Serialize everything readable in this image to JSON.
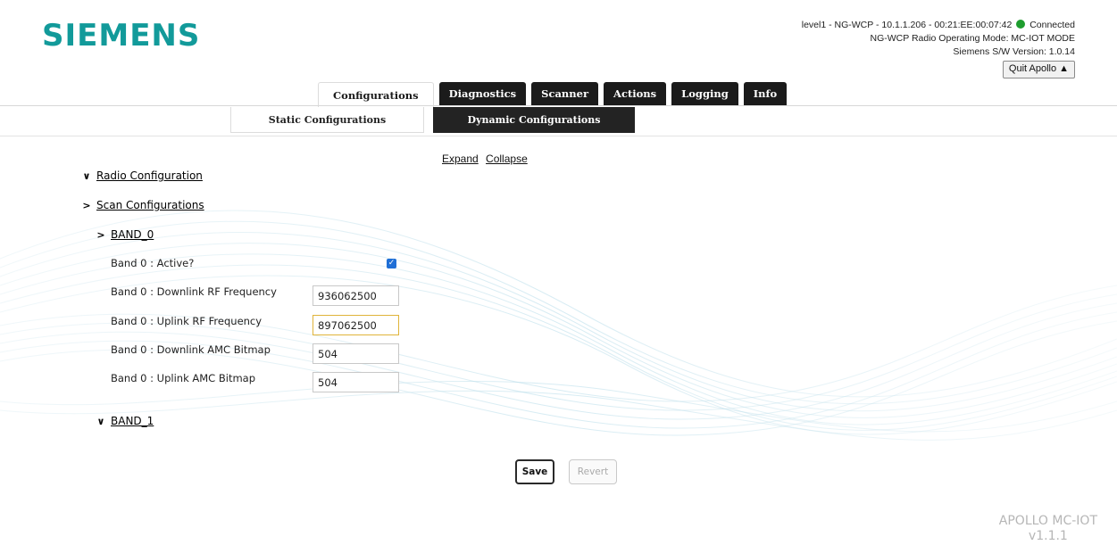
{
  "brand": {
    "logo_text": "SIEMENS",
    "logo_color": "#129a9a"
  },
  "status": {
    "connection_text": "level1 - NG-WCP - 10.1.1.206 - 00:21:EE:00:07:42",
    "connected_label": "Connected",
    "connected_color": "#1e9d2e",
    "operating_mode": "NG-WCP Radio Operating Mode: MC-IOT MODE",
    "sw_version": "Siemens S/W Version: 1.0.14",
    "quit_label": "Quit Apollo",
    "quit_icon": "warning-icon"
  },
  "main_tabs": [
    {
      "label": "Configurations",
      "active": true
    },
    {
      "label": "Diagnostics",
      "active": false
    },
    {
      "label": "Scanner",
      "active": false
    },
    {
      "label": "Actions",
      "active": false
    },
    {
      "label": "Logging",
      "active": false
    },
    {
      "label": "Info",
      "active": false
    }
  ],
  "sub_tabs": [
    {
      "label": "Static Configurations",
      "active": true
    },
    {
      "label": "Dynamic Configurations",
      "active": false
    }
  ],
  "tree_controls": {
    "expand_label": "Expand",
    "collapse_label": "Collapse"
  },
  "tree": {
    "radio_configuration": {
      "label": "Radio Configuration",
      "expanded": true
    },
    "scan_configurations": {
      "label": "Scan Configurations",
      "expanded": false
    },
    "band_0": {
      "label": "BAND_0",
      "expanded": false
    },
    "band_1": {
      "label": "BAND_1",
      "expanded": true
    }
  },
  "fields": [
    {
      "label": "Band 0 : Active?",
      "type": "checkbox",
      "checked": true
    },
    {
      "label": "Band 0 : Downlink RF Frequency",
      "value": "936062500"
    },
    {
      "label": "Band 0 : Uplink RF Frequency",
      "value": "897062500",
      "focused": true
    },
    {
      "label": "Band 0 : Downlink AMC Bitmap",
      "value": "504"
    },
    {
      "label": "Band 0 : Uplink AMC Bitmap",
      "value": "504"
    }
  ],
  "actions": {
    "save_label": "Save",
    "revert_label": "Revert"
  },
  "footer": {
    "product": "APOLLO MC-IOT",
    "version": "v1.1.1"
  }
}
